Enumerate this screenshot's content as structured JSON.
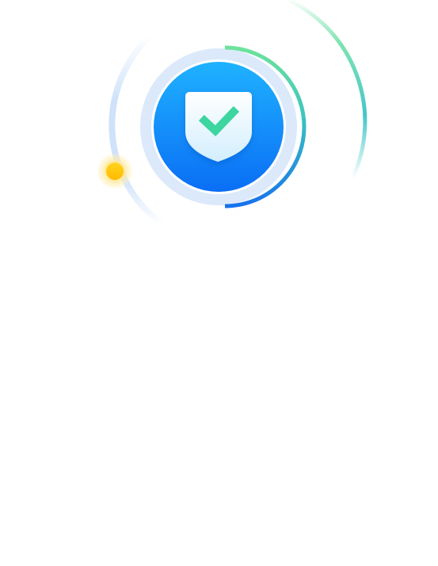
{
  "security_status": {
    "icon": "shield-check-icon",
    "status_dot_icon": "status-dot-icon",
    "colors": {
      "badge_top": "#1fb2ff",
      "badge_bottom": "#0a6ef5",
      "check": "#3dd5a0",
      "progress_green": "#5fdc9c",
      "progress_blue": "#1e82ee",
      "status_dot": "#ffc107",
      "halo": "#dbe9fb"
    }
  }
}
